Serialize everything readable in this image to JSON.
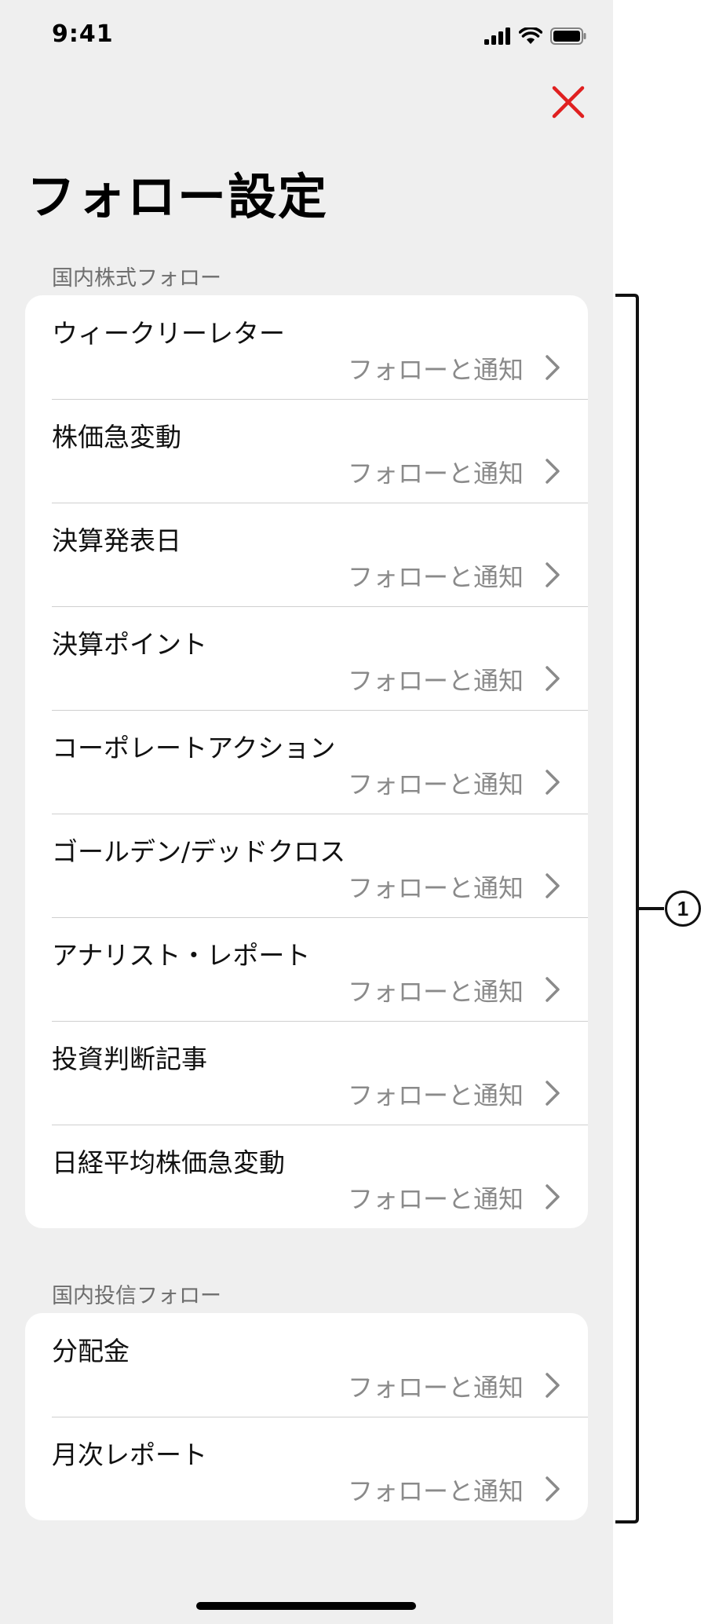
{
  "status_bar": {
    "time": "9:41",
    "icons": [
      "signal-icon",
      "wifi-icon",
      "battery-icon"
    ]
  },
  "header": {
    "close_icon": "close-icon",
    "close_color": "#e02020",
    "title": "フォロー設定"
  },
  "sections": [
    {
      "header": "国内株式フォロー",
      "rows": [
        {
          "title": "ウィークリーレター",
          "action": "フォローと通知"
        },
        {
          "title": "株価急変動",
          "action": "フォローと通知"
        },
        {
          "title": "決算発表日",
          "action": "フォローと通知"
        },
        {
          "title": "決算ポイント",
          "action": "フォローと通知"
        },
        {
          "title": "コーポレートアクション",
          "action": "フォローと通知"
        },
        {
          "title": "ゴールデン/デッドクロス",
          "action": "フォローと通知"
        },
        {
          "title": "アナリスト・レポート",
          "action": "フォローと通知"
        },
        {
          "title": "投資判断記事",
          "action": "フォローと通知"
        },
        {
          "title": "日経平均株価急変動",
          "action": "フォローと通知"
        }
      ]
    },
    {
      "header": "国内投信フォロー",
      "rows": [
        {
          "title": "分配金",
          "action": "フォローと通知"
        },
        {
          "title": "月次レポート",
          "action": "フォローと通知"
        }
      ]
    }
  ],
  "annotation": {
    "callout_number": "1"
  }
}
